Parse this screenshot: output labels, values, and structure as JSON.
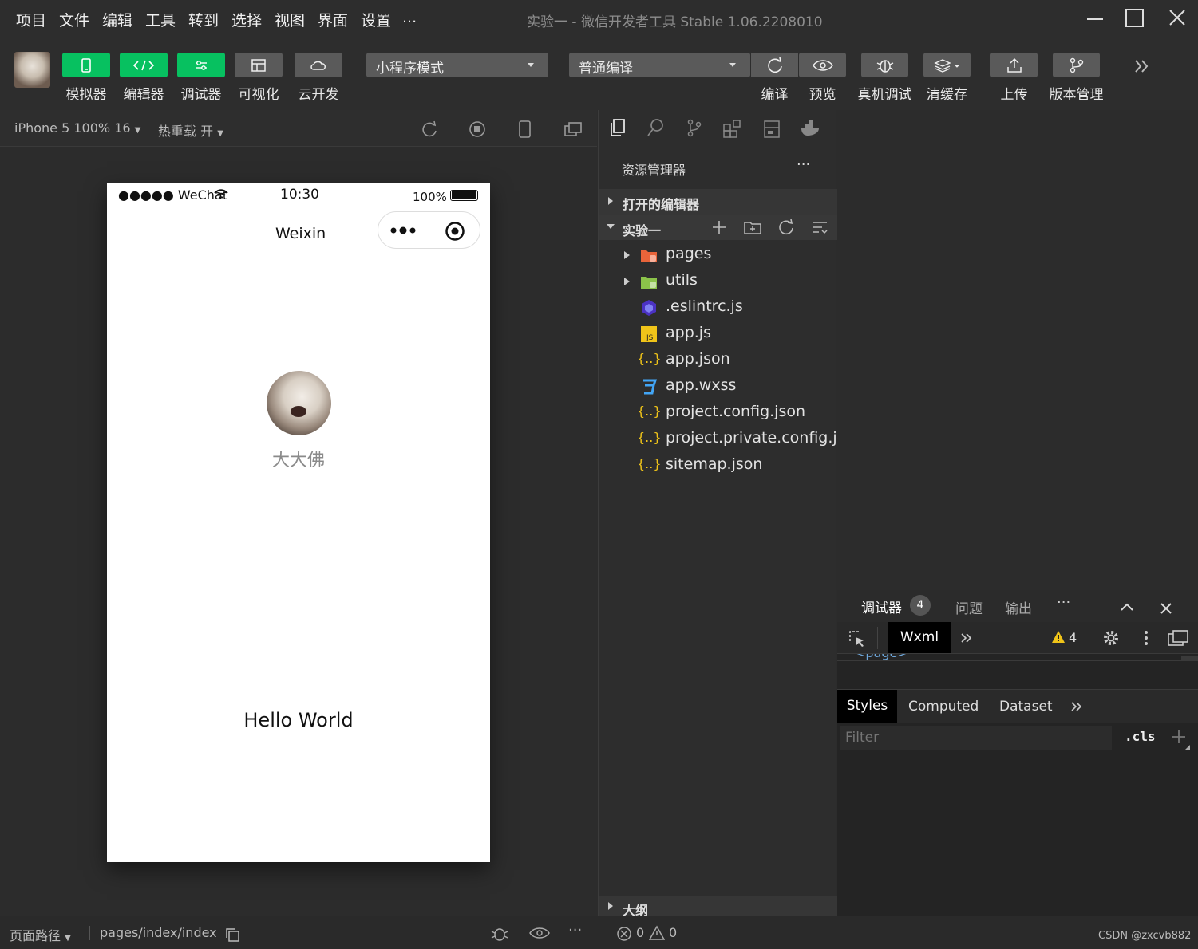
{
  "menu": {
    "items": [
      "项目",
      "文件",
      "编辑",
      "工具",
      "转到",
      "选择",
      "视图",
      "界面",
      "设置",
      "..."
    ],
    "window_title": "实验一 - 微信开发者工具 Stable 1.06.2208010"
  },
  "toolbar": {
    "buttons": [
      {
        "label": "模拟器",
        "icon": "phone-icon"
      },
      {
        "label": "编辑器",
        "icon": "code-icon"
      },
      {
        "label": "调试器",
        "icon": "debug-sliders-icon"
      },
      {
        "label": "可视化",
        "icon": "layout-icon"
      },
      {
        "label": "云开发",
        "icon": "cloud-icon"
      }
    ],
    "mode_select": "小程序模式",
    "compile_select": "普通编译",
    "right_buttons": [
      {
        "label": "编译",
        "icon": "refresh-icon"
      },
      {
        "label": "预览",
        "icon": "eye-icon"
      },
      {
        "label": "真机调试",
        "icon": "bug-icon"
      },
      {
        "label": "清缓存",
        "icon": "layers-icon"
      },
      {
        "label": "上传",
        "icon": "upload-icon"
      },
      {
        "label": "版本管理",
        "icon": "branch-icon"
      }
    ],
    "accent": "#07c160"
  },
  "simulator": {
    "device": "iPhone 5 100% 16",
    "hot_reload": "热重载 开"
  },
  "phone": {
    "carrier": "●●●●● WeChat",
    "time": "10:30",
    "battery": "100%",
    "nav_title": "Weixin",
    "user_name": "大大佛",
    "hello": "Hello World"
  },
  "explorer": {
    "title": "资源管理器",
    "more": "···",
    "open_editors": "打开的编辑器",
    "project": "实验一",
    "files": [
      {
        "name": "pages",
        "type": "folder"
      },
      {
        "name": "utils",
        "type": "folder"
      },
      {
        "name": ".eslintrc.js",
        "type": "eslint"
      },
      {
        "name": "app.js",
        "type": "js"
      },
      {
        "name": "app.json",
        "type": "json"
      },
      {
        "name": "app.wxss",
        "type": "css"
      },
      {
        "name": "project.config.json",
        "type": "json"
      },
      {
        "name": "project.private.config.js...",
        "type": "json"
      },
      {
        "name": "sitemap.json",
        "type": "json"
      }
    ],
    "outline": "大纲"
  },
  "debugger": {
    "tabs": [
      "调试器",
      "问题",
      "输出",
      "···"
    ],
    "badge": "4",
    "panel_tab": "Wxml",
    "warn_count": "4",
    "page_tag": "<page>",
    "style_tabs": [
      "Styles",
      "Computed",
      "Dataset"
    ],
    "filter_placeholder": "Filter",
    "cls": ".cls"
  },
  "status": {
    "path_label": "页面路径",
    "path": "pages/index/index",
    "errors": "0",
    "warnings": "0",
    "watermark": "CSDN @zxcvb882"
  }
}
